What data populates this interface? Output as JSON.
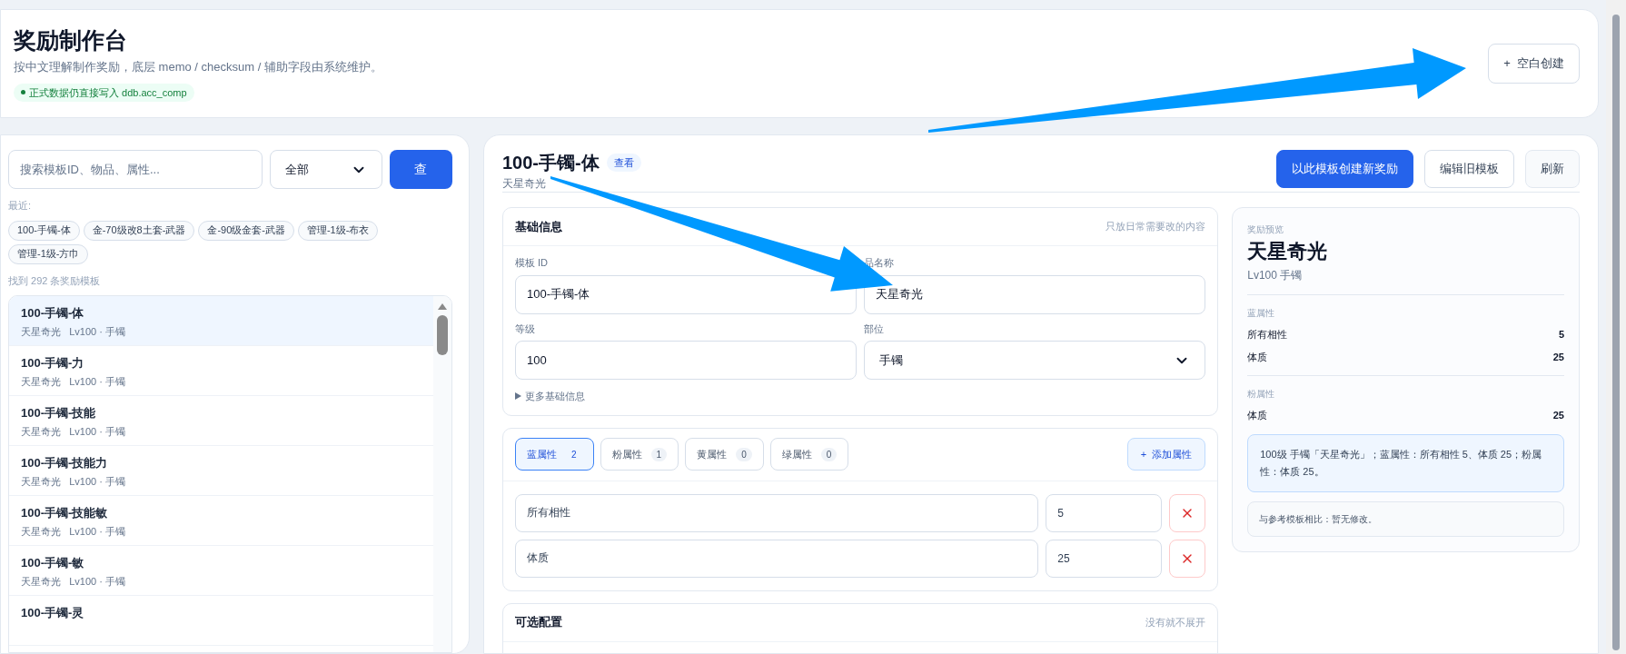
{
  "header": {
    "title": "奖励制作台",
    "subtitle": "按中文理解制作奖励，底层 memo / checksum / 辅助字段由系统维护。",
    "status": "正式数据仍直接写入 ddb.acc_comp",
    "blank_create": "+  空白创建"
  },
  "search": {
    "placeholder": "搜索模板ID、物品、属性...",
    "filter": "全部",
    "button": "查"
  },
  "recent": {
    "label": "最近:",
    "items": [
      "100-手镯-体",
      "金-70级改8土套-武器",
      "金-90级金套-武器",
      "管理-1级-布衣",
      "管理-1级-方巾"
    ]
  },
  "found": "找到 292 条奖励模板",
  "templates": [
    {
      "title": "100-手镯-体",
      "name": "天星奇光",
      "meta": "Lv100 · 手镯",
      "selected": true
    },
    {
      "title": "100-手镯-力",
      "name": "天星奇光",
      "meta": "Lv100 · 手镯",
      "selected": false
    },
    {
      "title": "100-手镯-技能",
      "name": "天星奇光",
      "meta": "Lv100 · 手镯",
      "selected": false
    },
    {
      "title": "100-手镯-技能力",
      "name": "天星奇光",
      "meta": "Lv100 · 手镯",
      "selected": false
    },
    {
      "title": "100-手镯-技能敏",
      "name": "天星奇光",
      "meta": "Lv100 · 手镯",
      "selected": false
    },
    {
      "title": "100-手镯-敏",
      "name": "天星奇光",
      "meta": "Lv100 · 手镯",
      "selected": false
    },
    {
      "title": "100-手镯-灵",
      "selected": false
    }
  ],
  "detail": {
    "title": "100-手镯-体",
    "badge": "查看",
    "subtitle": "天星奇光",
    "actions": [
      {
        "label": "以此模板创建新奖励",
        "kind": "primary"
      },
      {
        "label": "编辑旧模板",
        "kind": "outline"
      },
      {
        "label": "刷新",
        "kind": "muted"
      }
    ]
  },
  "basic": {
    "title": "基础信息",
    "hint": "只放日常需要改的内容",
    "fields": [
      {
        "label": "模板 ID",
        "value": "100-手镯-体",
        "kind": "text"
      },
      {
        "label": "品名称",
        "value": "天星奇光",
        "kind": "text"
      },
      {
        "label": "等级",
        "value": "100",
        "kind": "text"
      },
      {
        "label": "部位",
        "value": "手镯",
        "kind": "select"
      }
    ],
    "more": {
      "label": "更多基础信息",
      "expanded": false
    }
  },
  "attr_tabs": [
    {
      "label": "蓝属性",
      "count": "2",
      "selected": true
    },
    {
      "label": "粉属性",
      "count": "1",
      "selected": false
    },
    {
      "label": "黄属性",
      "count": "0",
      "selected": false
    },
    {
      "label": "绿属性",
      "count": "0",
      "selected": false
    }
  ],
  "add_attr": "+  添加属性",
  "attr_rows": [
    {
      "name": "所有相性",
      "value": "5"
    },
    {
      "name": "体质",
      "value": "25"
    }
  ],
  "optional": {
    "title": "可选配置",
    "hint": "没有就不展开"
  },
  "preview": {
    "label": "奖励预览",
    "name": "天星奇光",
    "meta": "Lv100 手镯",
    "groups": [
      {
        "title": "蓝属性",
        "rows": [
          {
            "name": "所有相性",
            "value": "5"
          },
          {
            "name": "体质",
            "value": "25"
          }
        ]
      },
      {
        "title": "粉属性",
        "rows": [
          {
            "name": "体质",
            "value": "25"
          }
        ]
      }
    ],
    "summary": "100级 手镯「天星奇光」；蓝属性：所有相性 5、体质 25；粉属性：体质 25。",
    "compare": "与参考模板相比：暂无修改。"
  }
}
